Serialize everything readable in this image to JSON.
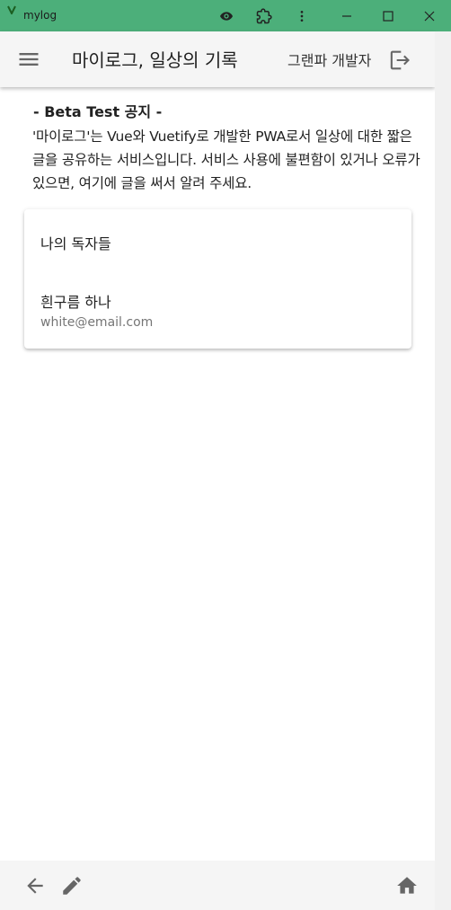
{
  "window": {
    "title": "mylog",
    "icons": [
      "app-logo-icon",
      "eye-icon",
      "extension-icon",
      "more-vert-icon",
      "minimize-icon",
      "maximize-icon",
      "close-icon"
    ]
  },
  "appbar": {
    "title": "마이로그, 일상의 기록",
    "user_name": "그랜파 개발자",
    "icons": [
      "menu-icon",
      "logout-icon"
    ]
  },
  "notice": {
    "heading": "- Beta Test 공지 -",
    "body": "'마이로그'는 Vue와 Vuetify로 개발한 PWA로서 일상에 대한 짧은 글을 공유하는 서비스입니다. 서비스 사용에 불편함이 있거나 오류가 있으면, 여기에 글을 써서 알려 주세요."
  },
  "readers_card": {
    "title": "나의 독자들",
    "readers": [
      {
        "name": "흰구름 하나",
        "email": "white@email.com"
      }
    ]
  },
  "bottom_nav": {
    "icons": [
      "arrow-back-icon",
      "pencil-icon",
      "home-icon"
    ]
  },
  "colors": {
    "titlebar": "#4caf7a",
    "appbar": "#f5f5f5",
    "text_primary": "#212121",
    "text_secondary": "#757575"
  }
}
